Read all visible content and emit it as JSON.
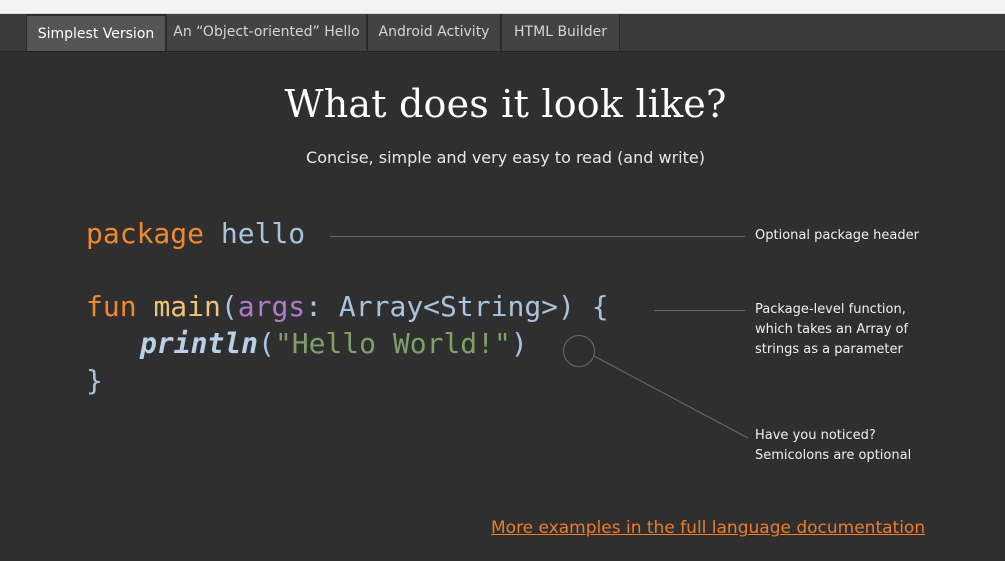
{
  "tabs": [
    {
      "label": "Simplest Version",
      "active": true
    },
    {
      "label": "An “Object-oriented” Hello",
      "active": false
    },
    {
      "label": "Android Activity",
      "active": false
    },
    {
      "label": "HTML Builder",
      "active": false
    }
  ],
  "heading": {
    "title": "What does it look like?",
    "subtitle": "Concise, simple and very easy to read (and write)"
  },
  "code": {
    "line1": {
      "keyword": "package",
      "name": "hello"
    },
    "line2": {
      "keyword": "fun",
      "name": "main",
      "open_paren": "(",
      "param": "args",
      "type": ": Array<String>) {"
    },
    "line3": {
      "call": "println",
      "open_paren": "(",
      "string": "\"Hello World!\"",
      "close_paren": ")"
    },
    "line4": {
      "brace": "}"
    }
  },
  "annotations": {
    "package_header": "Optional package header",
    "function_line1": "Package-level function,",
    "function_line2": "which takes an Array of",
    "function_line3": "strings as a parameter",
    "semicolons_line1": "Have you noticed?",
    "semicolons_line2": "Semicolons are optional"
  },
  "footer": {
    "link_text": "More examples in the full language documentation"
  },
  "colors": {
    "keyword": "#ef8a2c",
    "function_name": "#f1c27a",
    "parameter": "#b07acb",
    "string": "#7ea16a",
    "link": "#ef7b2c",
    "background": "#2f2f2f"
  }
}
